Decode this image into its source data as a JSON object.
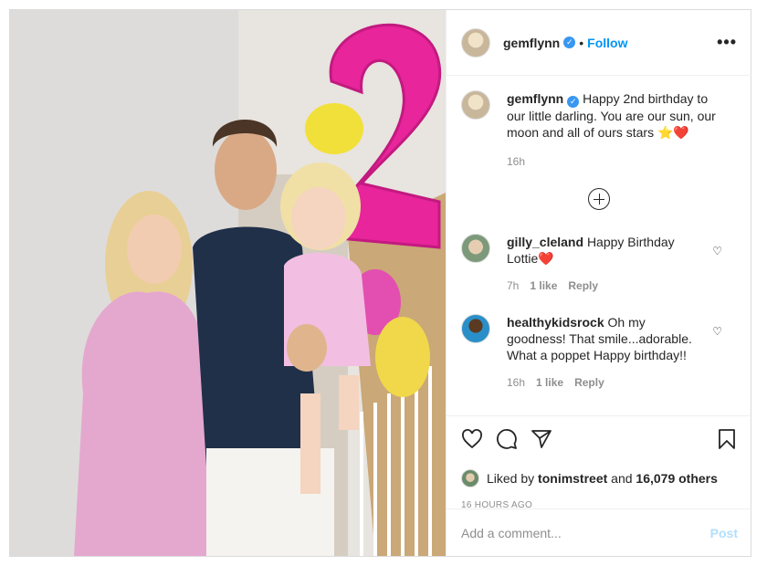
{
  "post": {
    "username": "gemflynn",
    "follow_label": "Follow",
    "dot": "•",
    "more_label": "•••"
  },
  "caption": {
    "username": "gemflynn",
    "text": "Happy 2nd birthday to our little darling. You are our sun, our moon and all of ours stars ⭐❤️",
    "time": "16h"
  },
  "comments": [
    {
      "username": "gilly_cleland",
      "text": "Happy Birthday Lottie❤️",
      "time": "7h",
      "likes": "1 like",
      "reply": "Reply"
    },
    {
      "username": "healthykidsrock",
      "text": "Oh my goodness! That smile...adorable. What a poppet Happy birthday!!",
      "time": "16h",
      "likes": "1 like",
      "reply": "Reply"
    }
  ],
  "likes": {
    "prefix": "Liked by",
    "user": "tonimstreet",
    "and": "and",
    "count": "16,079 others"
  },
  "timestamp": "16 HOURS AGO",
  "add_comment": {
    "placeholder": "Add a comment...",
    "post_label": "Post"
  },
  "colors": {
    "accent": "#0095f6",
    "balloon": "#e8259a",
    "verified": "#3897f0"
  }
}
